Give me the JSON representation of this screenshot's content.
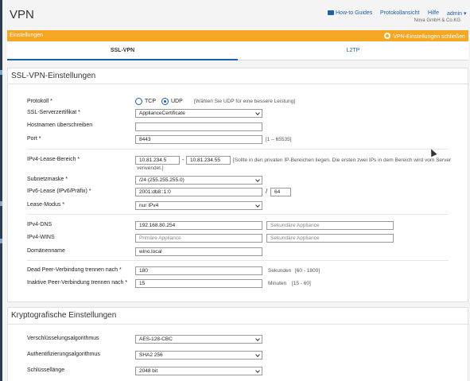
{
  "header": {
    "title": "VPN",
    "howto_label": "How-to Guides",
    "log_label": "Protokollansicht",
    "help_label": "Hilfe",
    "user_label": "admin ▾",
    "company": "Nova GmbH & Co.KG"
  },
  "banner": {
    "left_label": "Einstellungen",
    "right_label": "VPN-Einstellungen schließen"
  },
  "tabs": [
    "SSL-VPN",
    "L2TP"
  ],
  "ssl": {
    "section_title": "SSL-VPN-Einstellungen",
    "protocol_label": "Protokoll *",
    "tcp_label": "TCP",
    "udp_label": "UDP",
    "protocol_hint": "[Wählen Sie UDP für eine bessere Leistung]",
    "cert_label": "SSL-Serverzertifikat *",
    "cert_value": "ApplianceCertificate",
    "hostname_label": "Hostnamen überschreiben",
    "hostname_value": "",
    "port_label": "Port *",
    "port_value": "8443",
    "port_hint": "[1 – 65535]",
    "lease_label": "IPv4-Lease-Bereich *",
    "lease_from": "10.81.234.5",
    "lease_to": "10.81.234.55",
    "lease_hint_1": "[Sollte in den privaten IP-Bereichen liegen. Die ersten zwei IPs in dem Bereich wird vom Server",
    "lease_hint_2": "verwendet.]",
    "subnet_label": "Subnetzmaske *",
    "subnet_value": "/24 (255.255.255.0)",
    "ipv6_label": "IPv6-Lease (IPv6/Präfix) *",
    "ipv6_value": "2001:db8::1:0",
    "ipv6_prefix": "64",
    "lease_mode_label": "Lease-Modus *",
    "lease_mode_value": "nur IPv4",
    "dns_label": "IPv4-DNS",
    "dns_primary": "192.168.80.254",
    "dns_secondary": "Sekundäre Appliance",
    "wins_label": "IPv4-WINS",
    "wins_primary": "Primäre Appliance",
    "wins_secondary": "Sekundäre Appliance",
    "domain_label": "Domänenname",
    "domain_value": "wino.local",
    "dead_label": "Dead Peer-Verbindung trennen nach *",
    "dead_value": "180",
    "dead_unit": "Sekunden",
    "dead_range": "[60 - 1800]",
    "idle_label": "Inaktive Peer-Verbindung trennen nach *",
    "idle_value": "15",
    "idle_unit": "Minuten",
    "idle_range": "[15 - 60]"
  },
  "crypto": {
    "section_title": "Kryptografische Einstellungen",
    "enc_label": "Verschlüsselungsalgorithmus",
    "enc_value": "AES-128-CBC",
    "auth_label": "Authentifizierungsalgorithmus",
    "auth_value": "SHA2 256",
    "key_label": "Schlüssellänge",
    "key_value": "2048 bit"
  },
  "colors": {
    "accent": "#1f5fa8",
    "banner": "#f5a623"
  }
}
